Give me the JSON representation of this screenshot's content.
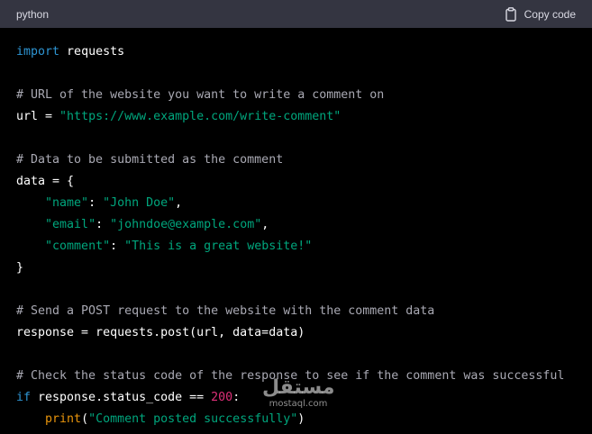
{
  "header": {
    "language": "python",
    "copy_label": "Copy code"
  },
  "code_lines": [
    [
      {
        "t": "import",
        "c": "kw"
      },
      {
        "t": " requests",
        "c": ""
      }
    ],
    [],
    [
      {
        "t": "# URL of the website you want to write a comment on",
        "c": "cm"
      }
    ],
    [
      {
        "t": "url = ",
        "c": ""
      },
      {
        "t": "\"https://www.example.com/write-comment\"",
        "c": "str"
      }
    ],
    [],
    [
      {
        "t": "# Data to be submitted as the comment",
        "c": "cm"
      }
    ],
    [
      {
        "t": "data = {",
        "c": ""
      }
    ],
    [
      {
        "t": "    ",
        "c": ""
      },
      {
        "t": "\"name\"",
        "c": "str"
      },
      {
        "t": ": ",
        "c": ""
      },
      {
        "t": "\"John Doe\"",
        "c": "str"
      },
      {
        "t": ",",
        "c": ""
      }
    ],
    [
      {
        "t": "    ",
        "c": ""
      },
      {
        "t": "\"email\"",
        "c": "str"
      },
      {
        "t": ": ",
        "c": ""
      },
      {
        "t": "\"johndoe@example.com\"",
        "c": "str"
      },
      {
        "t": ",",
        "c": ""
      }
    ],
    [
      {
        "t": "    ",
        "c": ""
      },
      {
        "t": "\"comment\"",
        "c": "str"
      },
      {
        "t": ": ",
        "c": ""
      },
      {
        "t": "\"This is a great website!\"",
        "c": "str"
      }
    ],
    [
      {
        "t": "}",
        "c": ""
      }
    ],
    [],
    [
      {
        "t": "# Send a POST request to the website with the comment data",
        "c": "cm"
      }
    ],
    [
      {
        "t": "response = requests.post(url, data=data)",
        "c": ""
      }
    ],
    [],
    [
      {
        "t": "# Check the status code of the response to see if the comment was successful",
        "c": "cm"
      }
    ],
    [
      {
        "t": "if",
        "c": "kw"
      },
      {
        "t": " response.status_code == ",
        "c": ""
      },
      {
        "t": "200",
        "c": "num"
      },
      {
        "t": ":",
        "c": ""
      }
    ],
    [
      {
        "t": "    ",
        "c": ""
      },
      {
        "t": "print",
        "c": "fny"
      },
      {
        "t": "(",
        "c": ""
      },
      {
        "t": "\"Comment posted successfully\"",
        "c": "str"
      },
      {
        "t": ")",
        "c": ""
      }
    ]
  ],
  "watermark": {
    "arabic": "مستقل",
    "latin": "mostaql.com"
  },
  "colors": {
    "header_bg": "#343541",
    "code_bg": "#000000",
    "keyword": "#2e95d3",
    "comment": "#a9a9b3",
    "string": "#00a67d",
    "number": "#df3079"
  }
}
